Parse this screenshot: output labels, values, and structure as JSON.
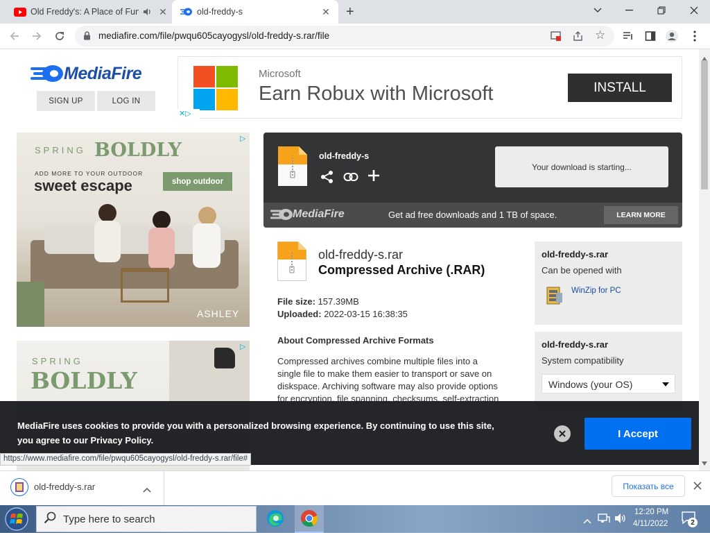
{
  "browser": {
    "tabs": [
      {
        "title": "Old Freddy's: A Place of Fun",
        "favicon": "youtube-icon",
        "active": false
      },
      {
        "title": "old-freddy-s",
        "favicon": "mediafire-icon",
        "active": true
      }
    ],
    "url": "mediafire.com/file/pwqu605cayogysl/old-freddy-s.rar/file",
    "status_url": "https://www.mediafire.com/file/pwqu605cayogysl/old-freddy-s.rar/file#"
  },
  "header": {
    "logo_text": "MediaFire",
    "sign_up": "SIGN UP",
    "log_in": "LOG IN"
  },
  "top_ad": {
    "brand": "Microsoft",
    "headline": "Earn Robux with Microsoft",
    "cta": "INSTALL"
  },
  "side_ads": [
    {
      "eyebrow": "SPRING",
      "headline": "BOLDLY",
      "line1": "ADD MORE TO YOUR OUTDOOR",
      "line2": "sweet escape",
      "cta": "shop outdoor",
      "brand": "ASHLEY"
    },
    {
      "eyebrow": "SPRING",
      "headline": "BOLDLY"
    }
  ],
  "download_panel": {
    "file_title": "old-freddy-s",
    "status": "Your download is starting...",
    "promo_logo": "MediaFire",
    "promo_text": "Get ad free downloads and 1 TB of space.",
    "learn_more": "LEARN MORE"
  },
  "file_info": {
    "filename": "old-freddy-s.rar",
    "type": "Compressed Archive (.RAR)",
    "size_label": "File size:",
    "size_value": "157.39MB",
    "uploaded_label": "Uploaded:",
    "uploaded_value": "2022-03-15 16:38:35",
    "about_title": "About Compressed Archive Formats",
    "about_text": "Compressed archives combine multiple files into a single file to make them easier to transport or save on diskspace. Archiving software may also provide options for encryption, file spanning, checksums, self-extraction"
  },
  "open_with_box": {
    "filename": "old-freddy-s.rar",
    "subtitle": "Can be opened with",
    "app": "WinZip for PC"
  },
  "compat_box": {
    "filename": "old-freddy-s.rar",
    "subtitle": "System compatibility",
    "os_select": "Windows (your OS)"
  },
  "cookie_banner": {
    "text": "MediaFire uses cookies to provide you with a personalized browsing experience. By continuing to use this site, you agree to our Privacy Policy.",
    "accept": "I Accept"
  },
  "download_bar": {
    "filename": "old-freddy-s.rar",
    "show_all": "Показать все"
  },
  "taskbar": {
    "search_placeholder": "Type here to search",
    "time": "12:20 PM",
    "date": "4/11/2022",
    "notification_count": "2"
  }
}
